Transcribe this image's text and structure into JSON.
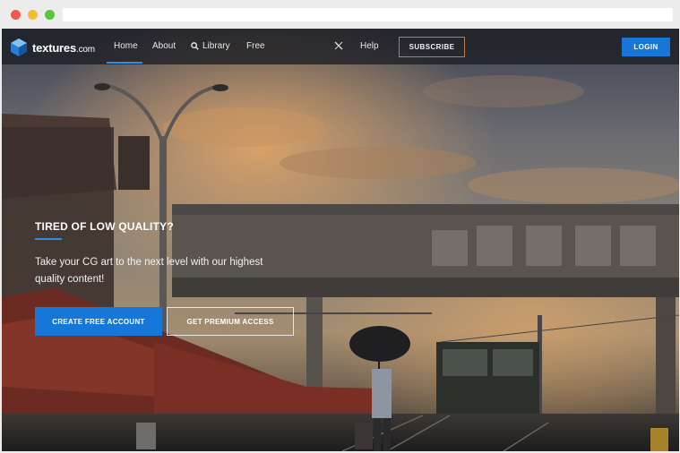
{
  "nav": {
    "logo_main": "textures",
    "logo_suffix": ".com",
    "links": {
      "home": "Home",
      "about": "About",
      "library": "Library",
      "free": "Free",
      "help": "Help"
    },
    "social_icon": "x-logo-icon",
    "subscribe_label": "SUBSCRIBE",
    "login_label": "LOGIN",
    "active_link": "Home"
  },
  "hero": {
    "title": "TIRED OF LOW QUALITY?",
    "subtitle": "Take your CG art to the next level with our highest quality content!",
    "primary_cta": "CREATE FREE ACCOUNT",
    "secondary_cta": "GET PREMIUM ACCESS"
  },
  "colors": {
    "accent_blue": "#1677d9",
    "subscribe_border": "#c77a3a",
    "nav_bg": "#1c1e24"
  },
  "icons": [
    "cube-logo-icon",
    "search-icon",
    "x-logo-icon"
  ]
}
